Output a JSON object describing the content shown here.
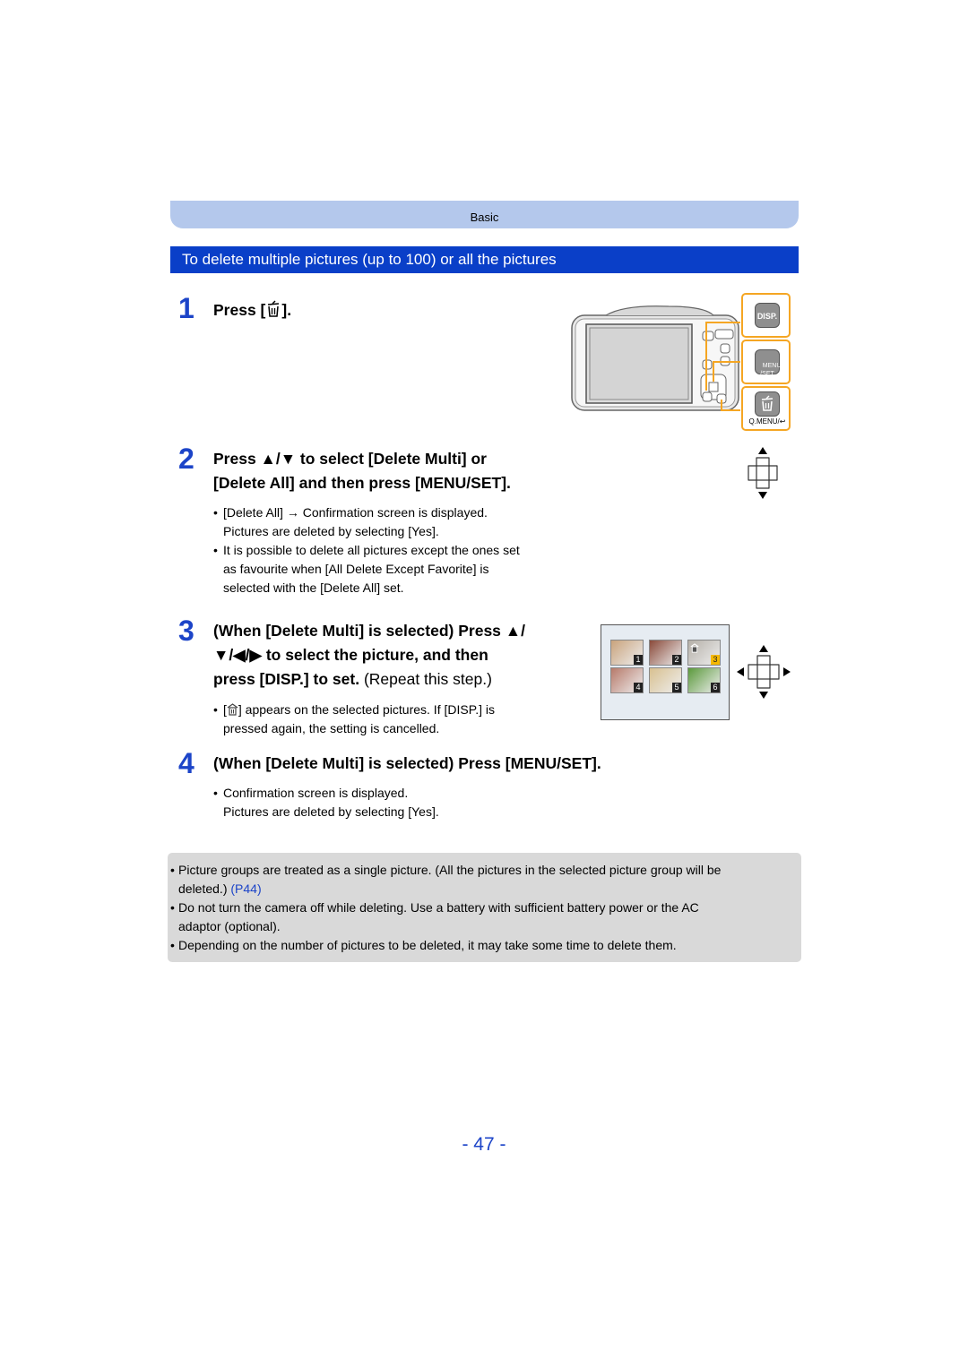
{
  "header": {
    "section_label": "Basic",
    "heading": "To delete multiple pictures (up to 100) or all the pictures"
  },
  "steps": [
    {
      "number": "1",
      "title_pre": "Press [",
      "title_icon": "trash-icon",
      "title_post": "]."
    },
    {
      "number": "2",
      "title_line1": "Press ▲/▼ to select [Delete Multi] or",
      "title_line2": "[Delete All] and then press [MENU/SET].",
      "bullets": [
        {
          "line1": "[Delete All] → Confirmation screen is displayed.",
          "line2": "Pictures are deleted by selecting [Yes]."
        },
        {
          "line1": "It is possible to delete all pictures except the ones set",
          "line2": "as favourite when [All Delete Except Favorite] is",
          "line3": "selected with the [Delete All] set."
        }
      ]
    },
    {
      "number": "3",
      "title_line1": "(When [Delete Multi] is selected) Press ▲/",
      "title_line2": "▼/◀/▶ to select the picture, and then",
      "title_line3_bold": "press [DISP.] to set.",
      "title_line3_normal": " (Repeat this step.)",
      "bullets": [
        {
          "line1_pre": "[",
          "line1_icon": "delete-mark-icon",
          "line1_post": "] appears on the selected pictures. If [DISP.] is",
          "line2": "pressed again, the setting is cancelled."
        }
      ]
    },
    {
      "number": "4",
      "title": "(When [Delete Multi] is selected) Press [MENU/SET].",
      "bullets": [
        {
          "line1": "Confirmation screen is displayed.",
          "line2": "Pictures are deleted by selecting [Yes]."
        }
      ]
    }
  ],
  "camera_illustration": {
    "buttons": [
      {
        "label": "DISP.",
        "name": "disp-button"
      },
      {
        "label": "MENU\n/SET",
        "name": "menu-set-button"
      },
      {
        "label": "🗑",
        "name": "delete-button"
      }
    ],
    "delete_caption": "Q.MENU/↩"
  },
  "thumbnails": {
    "items": [
      {
        "number": "1",
        "selected": false,
        "color": "#c9a37c"
      },
      {
        "number": "2",
        "selected": false,
        "color": "#8a4a3a"
      },
      {
        "number": "3",
        "selected": true,
        "color": "#b5b0a8"
      },
      {
        "number": "4",
        "selected": false,
        "color": "#b77a6a"
      },
      {
        "number": "5",
        "selected": false,
        "color": "#d8c090"
      },
      {
        "number": "6",
        "selected": false,
        "color": "#5b9a3c"
      }
    ]
  },
  "notes": [
    {
      "text": "Picture groups are treated as a single picture. (All the pictures in the selected picture group will be",
      "text2": "deleted.) ",
      "link": "(P44)"
    },
    {
      "text": "Do not turn the camera off while deleting. Use a battery with sufficient battery power or the AC",
      "text2": "adaptor (optional)."
    },
    {
      "text": "Depending on the number of pictures to be deleted, it may take some time to delete them."
    }
  ],
  "footer": {
    "page_number": "- 47 -"
  },
  "colors": {
    "accent_blue": "#1c44c8",
    "heading_bar": "#0a3fc8",
    "section_tab": "#b4c8ec",
    "highlight_orange": "#f5a623",
    "note_bg": "#d9d9d9"
  }
}
